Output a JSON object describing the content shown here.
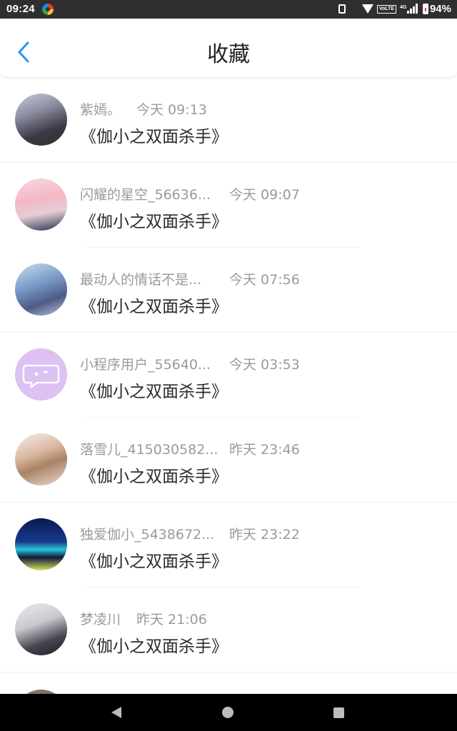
{
  "status_bar": {
    "time": "09:24",
    "volte": "VoLTE",
    "network": "4G",
    "battery": "94%"
  },
  "header": {
    "title": "收藏",
    "back_icon": "chevron-left-icon",
    "accent_color": "#2196f3"
  },
  "favorites": [
    {
      "username": "紫嫣。",
      "time": "今天 09:13",
      "book": "《伽小之双面杀手》"
    },
    {
      "username": "闪耀的星空_56636...",
      "time": "今天 09:07",
      "book": "《伽小之双面杀手》"
    },
    {
      "username": "最动人的情话不是...",
      "time": "今天 07:56",
      "book": "《伽小之双面杀手》"
    },
    {
      "username": "小程序用户_55640...",
      "time": "今天 03:53",
      "book": "《伽小之双面杀手》"
    },
    {
      "username": "落雪儿_415030582...",
      "time": "昨天 23:46",
      "book": "《伽小之双面杀手》"
    },
    {
      "username": "独爱伽小_5438672...",
      "time": "昨天 23:22",
      "book": "《伽小之双面杀手》"
    },
    {
      "username": "梦凌川",
      "time": "昨天 21:06",
      "book": "《伽小之双面杀手》"
    }
  ]
}
